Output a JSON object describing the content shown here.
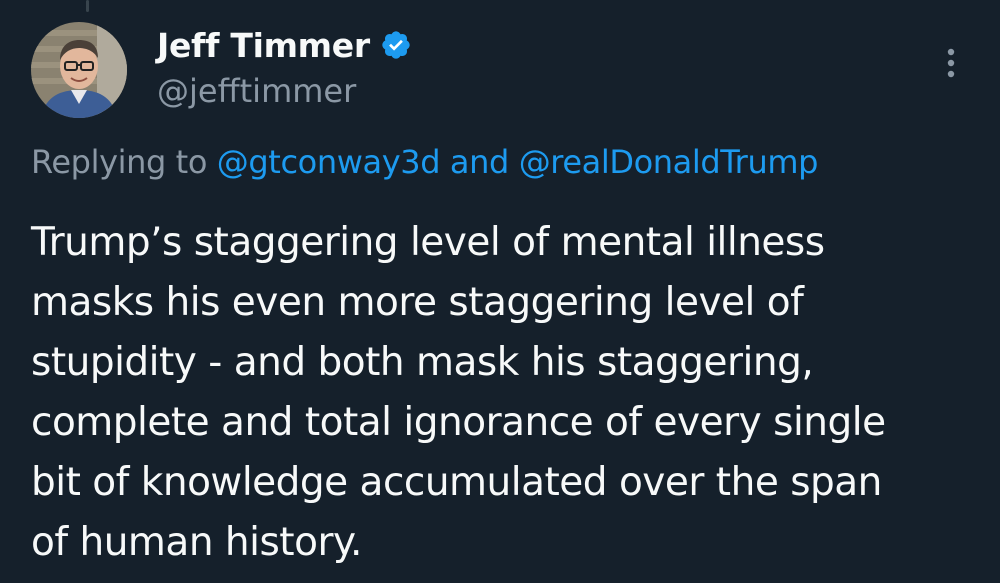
{
  "author": {
    "display_name": "Jeff Timmer",
    "handle": "@jefftimmer",
    "verified": true,
    "avatar_icon": "person-avatar-icon"
  },
  "reply": {
    "prefix": "Replying to",
    "mention_1": "@gtconway3d",
    "connector": "and",
    "mention_2": "@realDonaldTrump"
  },
  "tweet": {
    "text": "Trump’s staggering level of mental illness\nmasks his even more staggering level of\nstupidity - and both mask his staggering,\ncomplete and total ignorance of every single\nbit of knowledge accumulated over the span\nof human history."
  },
  "colors": {
    "background": "#15202b",
    "primary_text": "#f7f9f9",
    "secondary_text": "#8b98a5",
    "accent": "#1d9bf0"
  },
  "icons": {
    "verified": "verified-badge-icon",
    "more": "more-options-icon"
  }
}
